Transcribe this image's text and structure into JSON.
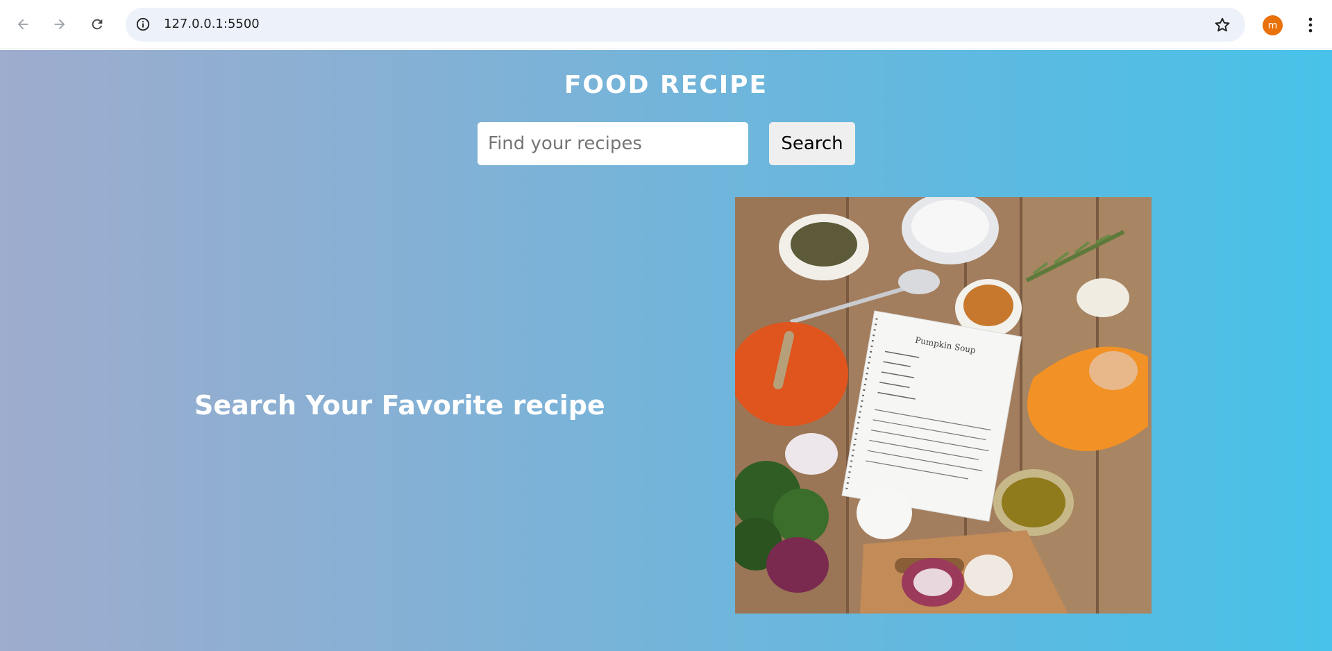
{
  "browser": {
    "url": "127.0.0.1:5500",
    "profile_initial": "m",
    "profile_color": "#e8710a"
  },
  "header": {
    "title": "FOOD RECIPE"
  },
  "search": {
    "placeholder": "Find your recipes",
    "value": "",
    "button_label": "Search"
  },
  "hero": {
    "text": "Search Your Favorite recipe",
    "image_icon": "recipe-ingredients-photo",
    "image_notepad_title": "Pumpkin Soup"
  },
  "colors": {
    "gradient_start": "#9eaccd",
    "gradient_end": "#48c2e9",
    "title_text": "#ffffff"
  }
}
